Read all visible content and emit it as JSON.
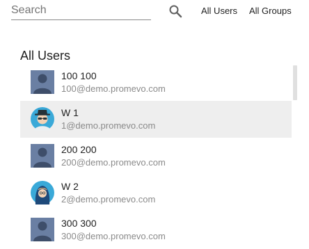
{
  "search": {
    "placeholder": "Search",
    "value": ""
  },
  "nav": {
    "all_users": "All Users",
    "all_groups": "All Groups"
  },
  "section": {
    "title": "All Users"
  },
  "users": [
    {
      "name": "100 100",
      "email": "100@demo.promevo.com",
      "avatar": "default-person-icon",
      "selected": false
    },
    {
      "name": "W 1",
      "email": "1@demo.promevo.com",
      "avatar": "hat-sunglasses-avatar",
      "selected": true
    },
    {
      "name": "200 200",
      "email": "200@demo.promevo.com",
      "avatar": "default-person-icon",
      "selected": false
    },
    {
      "name": "W 2",
      "email": "2@demo.promevo.com",
      "avatar": "hijab-woman-avatar",
      "selected": false
    },
    {
      "name": "300 300",
      "email": "300@demo.promevo.com",
      "avatar": "default-person-icon",
      "selected": false
    }
  ],
  "colors": {
    "selected_row": "#eeeeee",
    "default_avatar_bg": "#6a7fa3",
    "secondary_text": "#8a8a8a"
  }
}
